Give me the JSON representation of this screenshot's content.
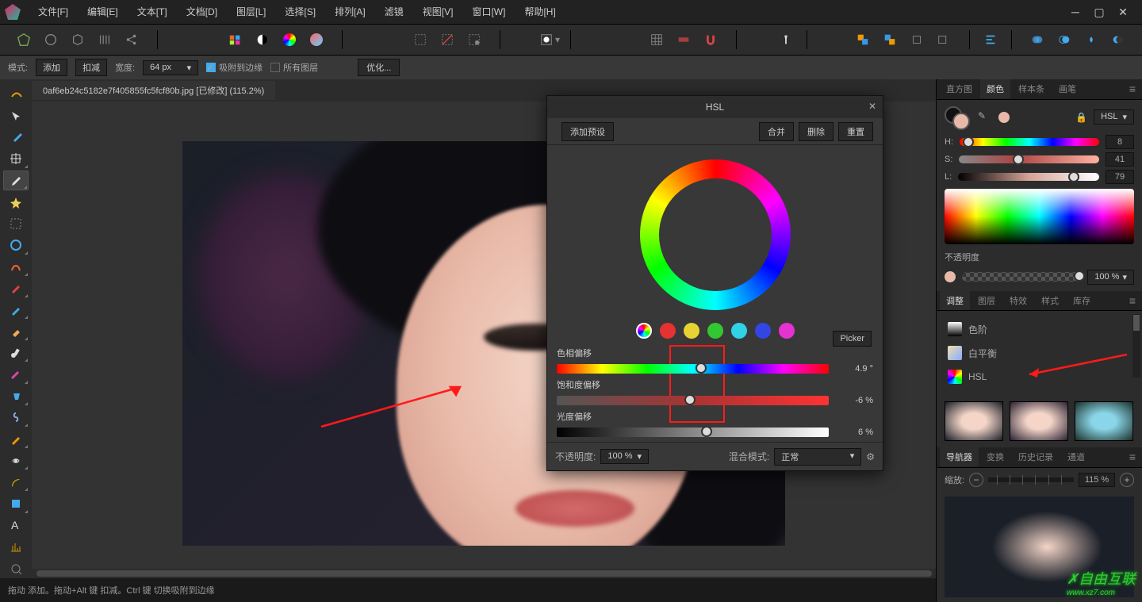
{
  "menu": [
    "文件[F]",
    "编辑[E]",
    "文本[T]",
    "文档[D]",
    "图层[L]",
    "选择[S]",
    "排列[A]",
    "滤镜",
    "视图[V]",
    "窗口[W]",
    "帮助[H]"
  ],
  "optionbar": {
    "mode_label": "模式:",
    "mode1": "添加",
    "mode2": "扣减",
    "width_label": "宽度:",
    "width_val": "64 px",
    "snap": "吸附到边缘",
    "all_layers": "所有图层",
    "optimize": "优化..."
  },
  "tab": {
    "title": "0af6eb24c5182e7f405855fc5fcf80b.jpg [已修改] (115.2%)"
  },
  "hsl_dialog": {
    "title": "HSL",
    "add_preset": "添加预设",
    "merge": "合并",
    "delete": "删除",
    "reset": "重置",
    "picker": "Picker",
    "hue_label": "色相偏移",
    "hue_val": "4.9 °",
    "sat_label": "饱和度偏移",
    "sat_val": "-6 %",
    "lum_label": "光度偏移",
    "lum_val": "6 %",
    "opacity_label": "不透明度:",
    "opacity_val": "100 %",
    "blend_label": "混合模式:",
    "blend_val": "正常",
    "swatches": [
      "conic",
      "#e63232",
      "#e6d232",
      "#32c832",
      "#32d2e6",
      "#3246e6",
      "#e632d2"
    ]
  },
  "right": {
    "color_tabs": [
      "直方图",
      "颜色",
      "样本条",
      "画笔"
    ],
    "active_color_tab": 1,
    "mode_label": "HSL",
    "H": {
      "label": "H:",
      "val": "8"
    },
    "S": {
      "label": "S:",
      "val": "41"
    },
    "L": {
      "label": "L:",
      "val": "79"
    },
    "opacity_label": "不透明度",
    "opacity_val": "100 %",
    "adjust_tabs": [
      "调整",
      "图层",
      "特效",
      "样式",
      "库存"
    ],
    "active_adjust_tab": 0,
    "adjust_items": [
      {
        "label": "色阶",
        "bg": "linear-gradient(#fff,#000)"
      },
      {
        "label": "白平衡",
        "bg": "linear-gradient(135deg,#f0e0b0,#88aaff)"
      },
      {
        "label": "HSL",
        "bg": "conic-gradient(red,yellow,lime,cyan,blue,magenta,red)"
      }
    ],
    "nav_tabs": [
      "导航器",
      "变换",
      "历史记录",
      "通道"
    ],
    "active_nav_tab": 0,
    "zoom_label": "缩放:",
    "zoom_val": "115 %"
  },
  "status": {
    "text": "拖动 添加。拖动+Alt 键 扣减。Ctrl 键 切换吸附到边缘"
  },
  "watermark": {
    "brand": "自由互联",
    "url": "www.xz7.com"
  }
}
